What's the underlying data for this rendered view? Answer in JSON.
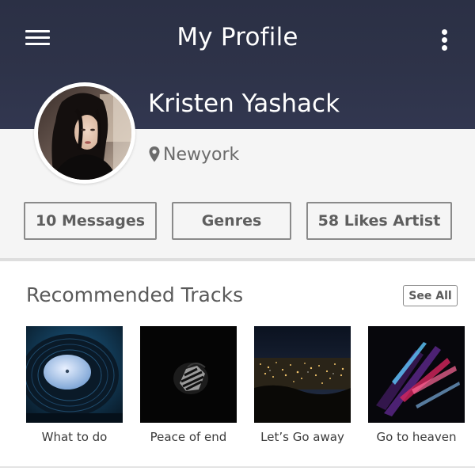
{
  "header": {
    "title": "My Profile",
    "menu_icon": "hamburger-menu-icon",
    "more_icon": "more-vertical-icon"
  },
  "profile": {
    "name": "Kristen Yashack",
    "location": "Newyork",
    "location_icon": "map-pin-icon"
  },
  "stats": {
    "messages": "10 Messages",
    "genres": "Genres",
    "likes": "58 Likes Artist"
  },
  "recommended": {
    "title": "Recommended Tracks",
    "see_all": "See All",
    "tracks": [
      {
        "title": "What to do"
      },
      {
        "title": "Peace of end"
      },
      {
        "title": "Let’s Go away"
      },
      {
        "title": "Go to heaven"
      }
    ]
  },
  "colors": {
    "header_bg": "#2e3349",
    "info_bg": "#f5f5f5",
    "button_border": "#8a8a8a",
    "text_muted": "#5e5e5e"
  }
}
